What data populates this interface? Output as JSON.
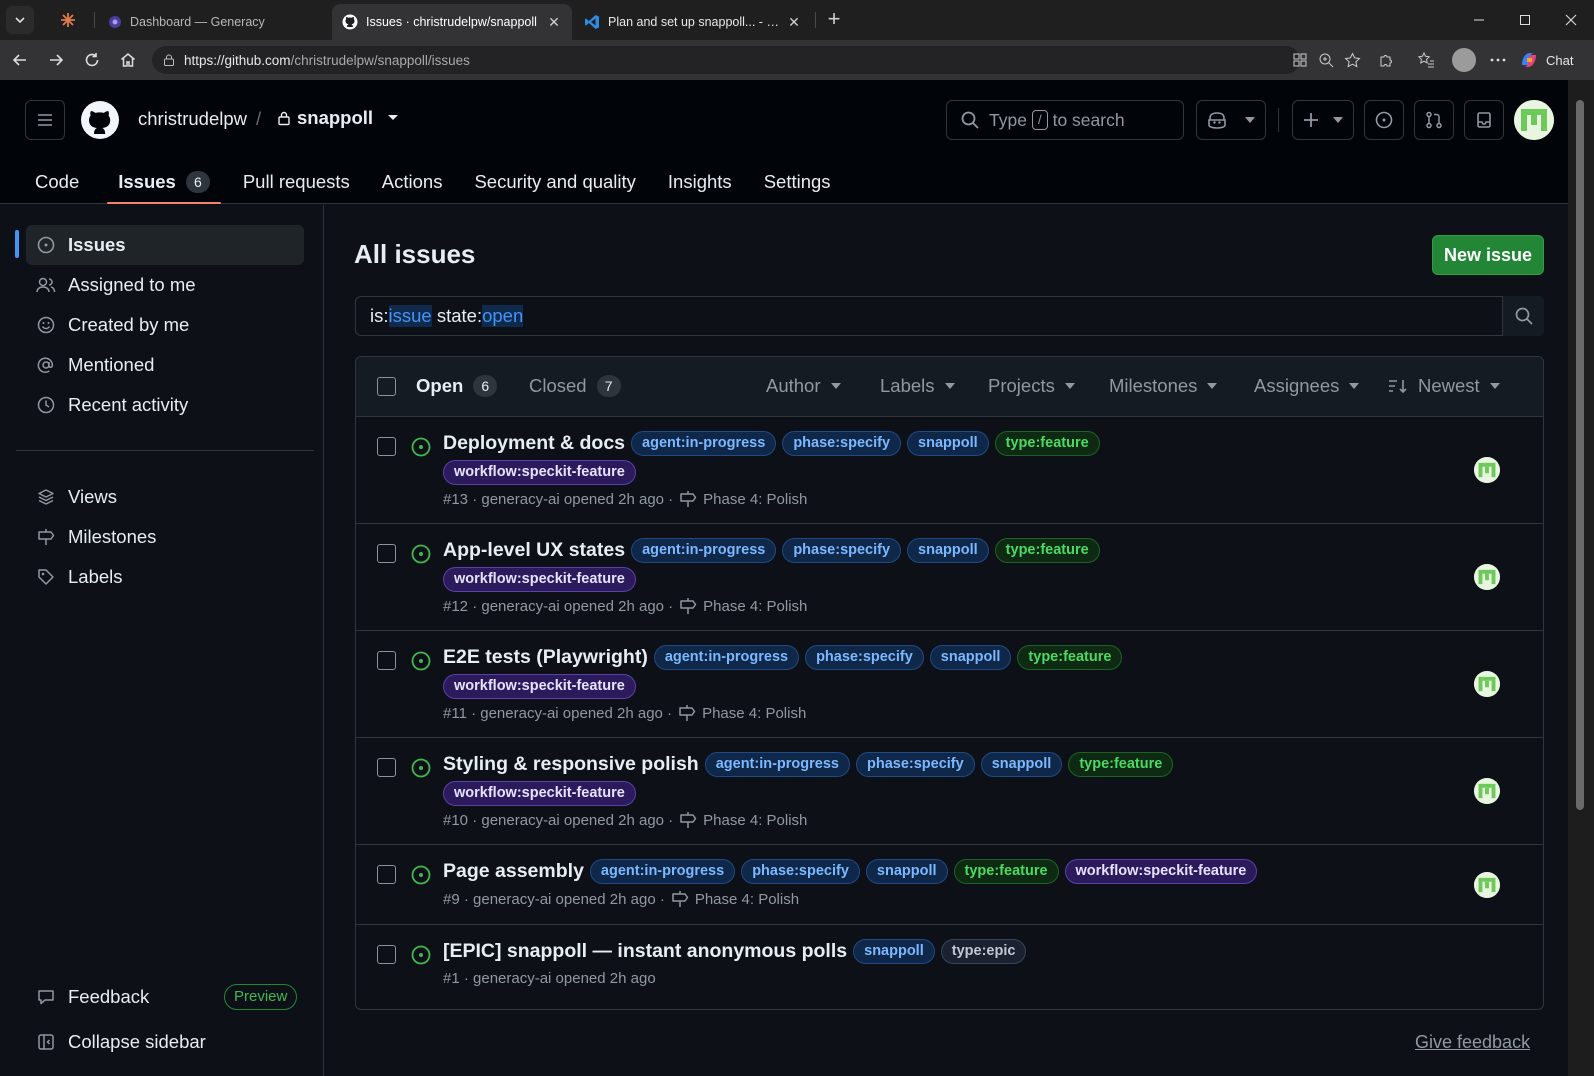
{
  "browser": {
    "tabs": [
      {
        "title": "Dashboard — Generacy"
      },
      {
        "title": "Issues · christrudelpw/snappoll"
      },
      {
        "title": "Plan and set up snappoll... - snapp"
      }
    ],
    "url_host": "https://github.com",
    "url_path": "/christrudelpw/snappoll/issues",
    "chat_label": "Chat"
  },
  "repo": {
    "owner": "christrudelpw",
    "name": "snappoll"
  },
  "search": {
    "prefix": "Type",
    "key": "/",
    "suffix": "to search"
  },
  "nav": {
    "code": "Code",
    "issues": "Issues",
    "issues_count": "6",
    "pulls": "Pull requests",
    "actions": "Actions",
    "security": "Security and quality",
    "insights": "Insights",
    "settings": "Settings"
  },
  "sidebar": {
    "issues": "Issues",
    "assigned": "Assigned to me",
    "created": "Created by me",
    "mentioned": "Mentioned",
    "recent": "Recent activity",
    "views": "Views",
    "milestones": "Milestones",
    "labels": "Labels",
    "feedback": "Feedback",
    "preview": "Preview",
    "collapse": "Collapse sidebar"
  },
  "main": {
    "title": "All issues",
    "new_issue": "New issue",
    "query": {
      "p1": "is:",
      "v1": "issue",
      "p2": " state:",
      "v2": "open"
    },
    "open_label": "Open",
    "open_count": "6",
    "closed_label": "Closed",
    "closed_count": "7",
    "filters": {
      "author": "Author",
      "labels": "Labels",
      "projects": "Projects",
      "milestones": "Milestones",
      "assignees": "Assignees",
      "sort": "Newest"
    },
    "give_feedback": "Give feedback"
  },
  "labels": {
    "agent": "agent:in-progress",
    "phase": "phase:specify",
    "snappoll": "snappoll",
    "feature": "type:feature",
    "workflow": "workflow:speckit-feature",
    "epic": "type:epic"
  },
  "issues": [
    {
      "title": "Deployment & docs",
      "meta": "#13 · generacy-ai opened 2h ago ·",
      "milestone": "Phase 4: Polish"
    },
    {
      "title": "App-level UX states",
      "meta": "#12 · generacy-ai opened 2h ago ·",
      "milestone": "Phase 4: Polish"
    },
    {
      "title": "E2E tests (Playwright)",
      "meta": "#11 · generacy-ai opened 2h ago ·",
      "milestone": "Phase 4: Polish"
    },
    {
      "title": "Styling & responsive polish",
      "meta": "#10 · generacy-ai opened 2h ago ·",
      "milestone": "Phase 4: Polish"
    },
    {
      "title": "Page assembly",
      "meta": "#9 · generacy-ai opened 2h ago ·",
      "milestone": "Phase 4: Polish"
    },
    {
      "title": "[EPIC] snappoll — instant anonymous polls",
      "meta": "#1 · generacy-ai opened 2h ago"
    }
  ],
  "colors": {
    "open_green": "#3fb950",
    "accent_blue": "#4493f8",
    "nav_underline": "#f78166",
    "button_green": "#238636"
  }
}
